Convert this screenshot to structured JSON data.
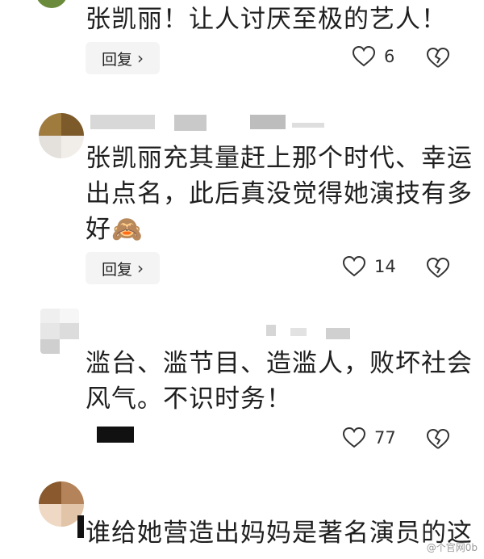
{
  "comments": [
    {
      "text_lines": [
        "张凯丽！让人讨厌至极的艺人！"
      ],
      "reply_label": "回复",
      "likes": "6"
    },
    {
      "text_lines": [
        "张凯丽充其量赶上那个时代、幸运",
        "出点名，此后真没觉得她演技有多",
        "好🙈"
      ],
      "reply_label": "回复",
      "likes": "14"
    },
    {
      "text_lines": [
        "滥台、滥节目、造滥人，败坏社会",
        "风气。不识时务！"
      ],
      "likes": "77"
    },
    {
      "text_lines": [
        "谁给她营造出妈妈是著名演员的这"
      ]
    }
  ],
  "icons": {
    "reply_chevron": "chevron-right-icon",
    "like": "heart-outline-icon",
    "dislike": "broken-heart-icon"
  },
  "watermark": "@个官网0b"
}
